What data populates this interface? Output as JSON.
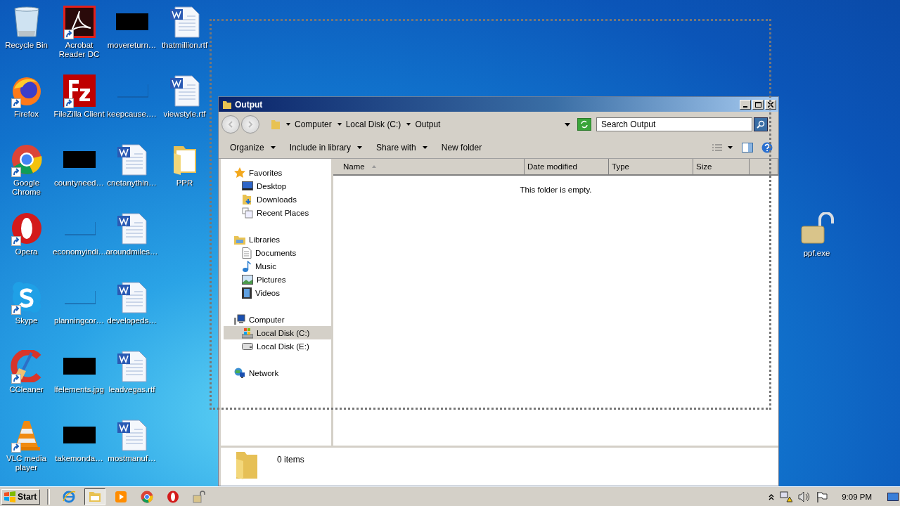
{
  "desktop_icons": [
    {
      "label": "Recycle Bin",
      "kind": "recycle",
      "shortcut": false
    },
    {
      "label": "Firefox",
      "kind": "firefox",
      "shortcut": true
    },
    {
      "label": "Google Chrome",
      "kind": "chrome",
      "shortcut": true
    },
    {
      "label": "Opera",
      "kind": "opera",
      "shortcut": true
    },
    {
      "label": "Skype",
      "kind": "skype",
      "shortcut": true
    },
    {
      "label": "CCleaner",
      "kind": "ccleaner",
      "shortcut": true
    },
    {
      "label": "VLC media player",
      "kind": "vlc",
      "shortcut": true
    },
    {
      "label": "Acrobat Reader DC",
      "kind": "acrobat",
      "shortcut": true
    },
    {
      "label": "FileZilla Client",
      "kind": "filezilla",
      "shortcut": true
    },
    {
      "label": "countyneed…",
      "kind": "black",
      "shortcut": false
    },
    {
      "label": "economyindi…",
      "kind": "blank",
      "shortcut": false
    },
    {
      "label": "planningcor…",
      "kind": "blank",
      "shortcut": false
    },
    {
      "label": "lfelements.jpg",
      "kind": "black",
      "shortcut": false
    },
    {
      "label": "takemonda…",
      "kind": "black",
      "shortcut": false
    },
    {
      "label": "movereturn…",
      "kind": "black",
      "shortcut": false
    },
    {
      "label": "keepcause.…",
      "kind": "blank",
      "shortcut": false
    },
    {
      "label": "cnetanythin…",
      "kind": "word",
      "shortcut": false
    },
    {
      "label": "aroundmiles…",
      "kind": "word",
      "shortcut": false
    },
    {
      "label": "developeds…",
      "kind": "word",
      "shortcut": false
    },
    {
      "label": "leadvegas.rtf",
      "kind": "word",
      "shortcut": false
    },
    {
      "label": "mostmanuf…",
      "kind": "word",
      "shortcut": false
    },
    {
      "label": "thatmillion.rtf",
      "kind": "word",
      "shortcut": false
    },
    {
      "label": "viewstyle.rtf",
      "kind": "word",
      "shortcut": false
    },
    {
      "label": "PPR",
      "kind": "folder",
      "shortcut": false
    }
  ],
  "extra_desktop_icon": {
    "label": "ppf.exe",
    "kind": "lock"
  },
  "window": {
    "title": "Output",
    "breadcrumbs": [
      "Computer",
      "Local Disk (C:)",
      "Output"
    ],
    "search": {
      "placeholder": "Search Output"
    },
    "toolbar": [
      {
        "label": "Organize",
        "dropdown": true
      },
      {
        "label": "Include in library",
        "dropdown": true
      },
      {
        "label": "Share with",
        "dropdown": true
      },
      {
        "label": "New folder",
        "dropdown": false
      }
    ],
    "nav": [
      {
        "label": "Favorites",
        "kind": "star",
        "selected": false,
        "children": [
          {
            "label": "Desktop",
            "kind": "desktop",
            "selected": false
          },
          {
            "label": "Downloads",
            "kind": "downloads",
            "selected": false
          },
          {
            "label": "Recent Places",
            "kind": "recent",
            "selected": false
          }
        ]
      },
      {
        "label": "Libraries",
        "kind": "libraries",
        "selected": false,
        "children": [
          {
            "label": "Documents",
            "kind": "documents",
            "selected": false
          },
          {
            "label": "Music",
            "kind": "music",
            "selected": false
          },
          {
            "label": "Pictures",
            "kind": "pictures",
            "selected": false
          },
          {
            "label": "Videos",
            "kind": "videos",
            "selected": false
          }
        ]
      },
      {
        "label": "Computer",
        "kind": "computer",
        "selected": false,
        "children": [
          {
            "label": "Local Disk (C:)",
            "kind": "sysdisk",
            "selected": true
          },
          {
            "label": "Local Disk (E:)",
            "kind": "disk",
            "selected": false
          }
        ]
      },
      {
        "label": "Network",
        "kind": "network",
        "selected": false
      }
    ],
    "columns": [
      {
        "label": "Name",
        "sorted": true
      },
      {
        "label": "Date modified",
        "sorted": false
      },
      {
        "label": "Type",
        "sorted": false
      },
      {
        "label": "Size",
        "sorted": false
      }
    ],
    "empty_message": "This folder is empty.",
    "status": "0 items"
  },
  "taskbar": {
    "start": "Start",
    "apps": [
      {
        "kind": "ie",
        "selected": false
      },
      {
        "kind": "explorer",
        "selected": true
      },
      {
        "kind": "media",
        "selected": false
      },
      {
        "kind": "chrome",
        "selected": false
      },
      {
        "kind": "opera",
        "selected": false
      },
      {
        "kind": "lockapp",
        "selected": false
      }
    ],
    "clock": "9:09 PM"
  }
}
